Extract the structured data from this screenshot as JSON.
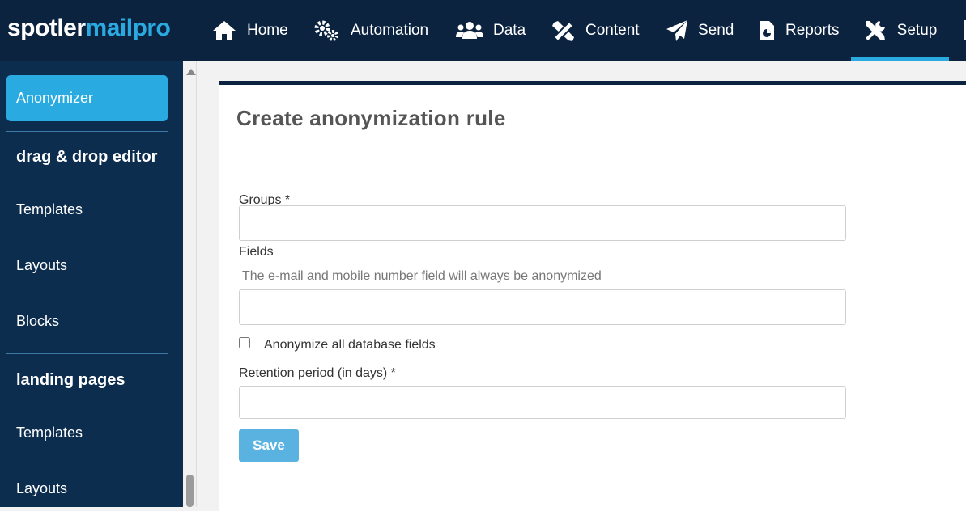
{
  "brand": {
    "logo_part1": "spotler",
    "logo_part2": "mailpro",
    "accent": "#29abe2",
    "navy": "#0c2340"
  },
  "topnav": {
    "items": [
      {
        "label": "Home",
        "icon": "home-icon"
      },
      {
        "label": "Automation",
        "icon": "gears-icon"
      },
      {
        "label": "Data",
        "icon": "users-icon"
      },
      {
        "label": "Content",
        "icon": "pencil-ruler-icon"
      },
      {
        "label": "Send",
        "icon": "paper-plane-icon"
      },
      {
        "label": "Reports",
        "icon": "report-icon"
      },
      {
        "label": "Setup",
        "icon": "tools-icon"
      }
    ],
    "active": "Setup"
  },
  "sidebar": {
    "active_item": "Anonymizer",
    "section1": {
      "heading": "drag & drop editor",
      "items": [
        "Templates",
        "Layouts",
        "Blocks"
      ]
    },
    "section2": {
      "heading": "landing pages",
      "items": [
        "Templates",
        "Layouts"
      ]
    }
  },
  "form": {
    "title": "Create anonymization rule",
    "groups_label": "Groups *",
    "groups_value": "",
    "fields_label": "Fields",
    "fields_hint": "The e-mail and mobile number field will always be anonymized",
    "fields_value": "",
    "anonymize_all_label": "Anonymize all database fields",
    "anonymize_all_checked": false,
    "retention_label": "Retention period (in days) *",
    "retention_value": "",
    "save_label": "Save"
  }
}
